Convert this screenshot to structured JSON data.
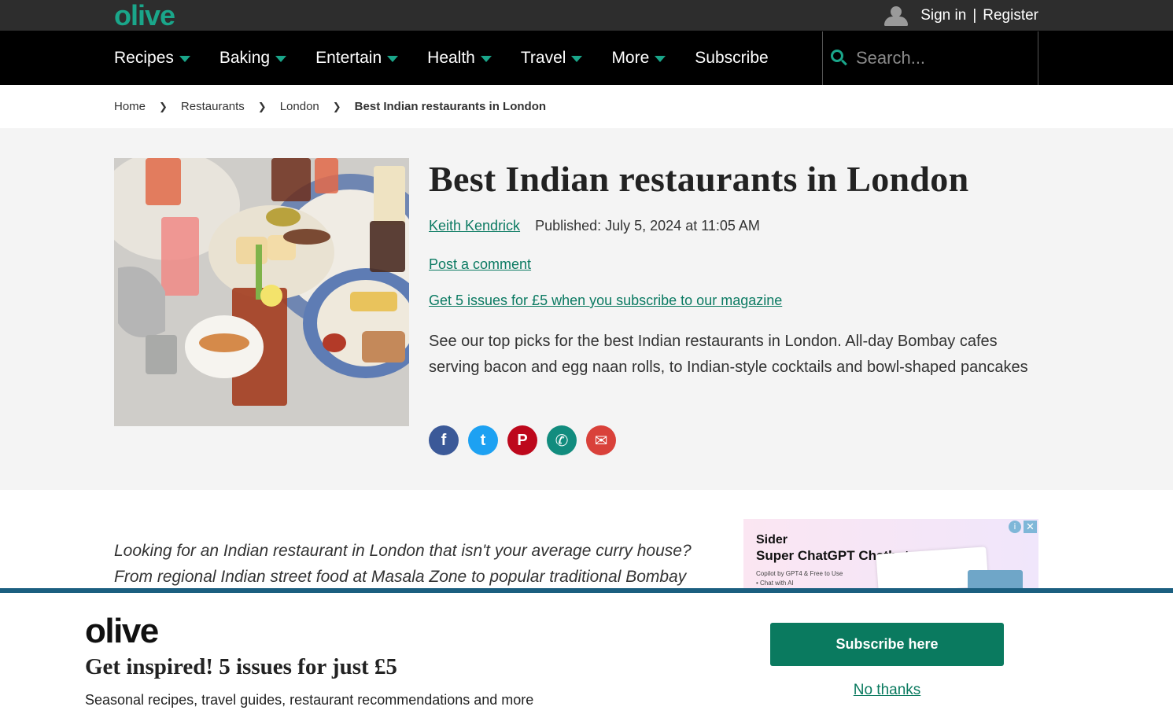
{
  "header": {
    "logo": "olive",
    "sign_in": "Sign in",
    "separator": "|",
    "register": "Register"
  },
  "nav": {
    "items": [
      {
        "label": "Recipes",
        "dropdown": true
      },
      {
        "label": "Baking",
        "dropdown": true
      },
      {
        "label": "Entertain",
        "dropdown": true
      },
      {
        "label": "Health",
        "dropdown": true
      },
      {
        "label": "Travel",
        "dropdown": true
      },
      {
        "label": "More",
        "dropdown": true
      },
      {
        "label": "Subscribe",
        "dropdown": false
      }
    ],
    "search_placeholder": "Search..."
  },
  "breadcrumb": {
    "items": [
      "Home",
      "Restaurants",
      "London",
      "Best Indian restaurants in London"
    ],
    "separator": "❯"
  },
  "article": {
    "title": "Best Indian restaurants in London",
    "author": "Keith Kendrick",
    "published": "Published: July 5, 2024 at 11:05 AM",
    "comment_link": "Post a comment",
    "promo_link": "Get 5 issues for £5 when you subscribe to our magazine",
    "standfirst": "See our top picks for the best Indian restaurants in London. All-day Bombay cafes serving bacon and egg naan rolls, to Indian-style cocktails and bowl-shaped pancakes",
    "intro": "Looking for an Indian restaurant in London that isn't your average curry house? From regional Indian street food at Masala Zone to popular traditional Bombay cafe empire"
  },
  "share": {
    "buttons": [
      {
        "name": "facebook-icon",
        "glyph": "f",
        "color": "#3b5998"
      },
      {
        "name": "twitter-icon",
        "glyph": "t",
        "color": "#1da1f2"
      },
      {
        "name": "pinterest-icon",
        "glyph": "P",
        "color": "#bd081c"
      },
      {
        "name": "whatsapp-icon",
        "glyph": "✆",
        "color": "#128c7e"
      },
      {
        "name": "email-icon",
        "glyph": "✉",
        "color": "#d9413a"
      }
    ]
  },
  "ad": {
    "brand": "Sider",
    "title": "Super ChatGPT Chatbot",
    "sub_line1": "Copilot by GPT4 & Free to Use",
    "sub_line2": "• Chat with AI",
    "info": "i",
    "close": "✕"
  },
  "overlay": {
    "logo": "olive",
    "title": "Get inspired! 5 issues for just £5",
    "description": "Seasonal recipes, travel guides, restaurant recommendations and more",
    "subscribe_button": "Subscribe here",
    "no_thanks": "No thanks"
  },
  "colors": {
    "accent": "#1aa68a",
    "link": "#0b7a62",
    "button": "#0a7a5f",
    "overlay_border": "#1b5f80"
  }
}
